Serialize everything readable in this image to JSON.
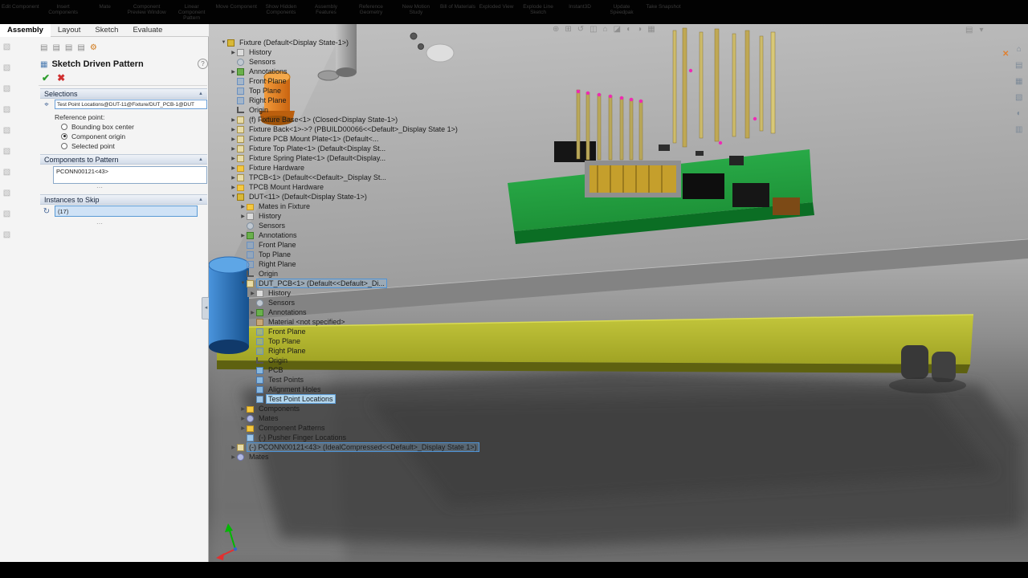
{
  "window": {
    "top_ribbon_labels": [
      "Edit Component",
      "Insert Components",
      "Mate",
      "Component Preview Window",
      "Linear Component Pattern",
      "Move Component",
      "Show Hidden Components",
      "Assembly Features",
      "Reference Geometry",
      "New Motion Study",
      "Bill of Materials",
      "Exploded View",
      "Explode Line Sketch",
      "Instant3D",
      "Update Speedpak",
      "Take Snapshot"
    ]
  },
  "tabs": {
    "items": [
      {
        "label": "Assembly",
        "active": true
      },
      {
        "label": "Layout",
        "active": false
      },
      {
        "label": "Sketch",
        "active": false
      },
      {
        "label": "Evaluate",
        "active": false
      }
    ]
  },
  "left_strip": {
    "icons": [
      "tool-icon-1",
      "tool-icon-2",
      "tool-icon-3",
      "tool-icon-4",
      "tool-icon-5",
      "tool-icon-6",
      "tool-icon-7",
      "tool-icon-8",
      "tool-icon-9",
      "tool-icon-10"
    ]
  },
  "property_manager": {
    "tab_icons": [
      "featuremanager-tab-icon",
      "propertymanager-tab-icon",
      "configuration-manager-tab-icon",
      "dimxpert-manager-tab-icon",
      "display-manager-tab-icon"
    ],
    "title": "Sketch Driven Pattern",
    "help_label": "?",
    "ok_glyph": "✔",
    "cancel_glyph": "✖",
    "groups": {
      "selections": {
        "label": "Selections",
        "field_value": "Test Point Locations@DUT-11@Fixture/DUT_PCB-1@DUT",
        "reference_point_label": "Reference point:",
        "radios": [
          {
            "label": "Bounding box center",
            "selected": false
          },
          {
            "label": "Component origin",
            "selected": true
          },
          {
            "label": "Selected point",
            "selected": false
          }
        ]
      },
      "components": {
        "label": "Components to Pattern",
        "items": [
          "PCONN00121<43>"
        ]
      },
      "instances": {
        "label": "Instances to Skip",
        "field_value": "(17)"
      }
    }
  },
  "feature_tree": {
    "rows": [
      {
        "l": 0,
        "a": "d",
        "i": "asm",
        "t": "Fixture  (Default<Display State-1>)"
      },
      {
        "l": 1,
        "a": "r",
        "i": "history",
        "t": "History"
      },
      {
        "l": 1,
        "a": "",
        "i": "sensors",
        "t": "Sensors"
      },
      {
        "l": 1,
        "a": "r",
        "i": "ann",
        "t": "Annotations"
      },
      {
        "l": 1,
        "a": "",
        "i": "plane",
        "t": "Front Plane"
      },
      {
        "l": 1,
        "a": "",
        "i": "plane",
        "t": "Top Plane"
      },
      {
        "l": 1,
        "a": "",
        "i": "plane",
        "t": "Right Plane"
      },
      {
        "l": 1,
        "a": "",
        "i": "origin",
        "t": "Origin"
      },
      {
        "l": 1,
        "a": "r",
        "i": "part",
        "t": "(f) Fixture Base<1> (Closed<Display State-1>)"
      },
      {
        "l": 1,
        "a": "r",
        "i": "part",
        "t": "Fixture Back<1>->? (PBUILD00066<<Default>_Display State 1>)"
      },
      {
        "l": 1,
        "a": "r",
        "i": "part",
        "t": "Fixture PCB Mount Plate<1> (Default<..."
      },
      {
        "l": 1,
        "a": "r",
        "i": "part",
        "t": "Fixture Top Plate<1> (Default<Display St..."
      },
      {
        "l": 1,
        "a": "r",
        "i": "part",
        "t": "Fixture Spring Plate<1> (Default<Display..."
      },
      {
        "l": 1,
        "a": "r",
        "i": "folder",
        "t": "Fixture Hardware"
      },
      {
        "l": 1,
        "a": "r",
        "i": "part",
        "t": "TPCB<1> (Default<<Default>_Display St..."
      },
      {
        "l": 1,
        "a": "r",
        "i": "folder",
        "t": "TPCB Mount Hardware"
      },
      {
        "l": 1,
        "a": "d",
        "i": "asm",
        "t": "DUT<11> (Default<Display State-1>)"
      },
      {
        "l": 2,
        "a": "r",
        "i": "folder",
        "t": "Mates in Fixture"
      },
      {
        "l": 2,
        "a": "r",
        "i": "history",
        "t": "History"
      },
      {
        "l": 2,
        "a": "",
        "i": "sensors",
        "t": "Sensors"
      },
      {
        "l": 2,
        "a": "r",
        "i": "ann",
        "t": "Annotations"
      },
      {
        "l": 2,
        "a": "",
        "i": "plane",
        "t": "Front Plane"
      },
      {
        "l": 2,
        "a": "",
        "i": "plane",
        "t": "Top Plane"
      },
      {
        "l": 2,
        "a": "",
        "i": "plane",
        "t": "Right Plane"
      },
      {
        "l": 2,
        "a": "",
        "i": "origin",
        "t": "Origin"
      },
      {
        "l": 2,
        "a": "d",
        "i": "part",
        "t": "DUT_PCB<1> (Default<<Default>_Di...",
        "s": "outline"
      },
      {
        "l": 3,
        "a": "r",
        "i": "history",
        "t": "History"
      },
      {
        "l": 3,
        "a": "",
        "i": "sensors",
        "t": "Sensors"
      },
      {
        "l": 3,
        "a": "r",
        "i": "ann",
        "t": "Annotations"
      },
      {
        "l": 3,
        "a": "",
        "i": "mat",
        "t": "Material <not specified>"
      },
      {
        "l": 3,
        "a": "",
        "i": "plane",
        "t": "Front Plane"
      },
      {
        "l": 3,
        "a": "",
        "i": "plane",
        "t": "Top Plane"
      },
      {
        "l": 3,
        "a": "",
        "i": "plane",
        "t": "Right Plane"
      },
      {
        "l": 3,
        "a": "",
        "i": "origin",
        "t": "Origin"
      },
      {
        "l": 3,
        "a": "",
        "i": "feat",
        "t": "PCB"
      },
      {
        "l": 3,
        "a": "",
        "i": "feat",
        "t": "Test Points"
      },
      {
        "l": 3,
        "a": "",
        "i": "feat",
        "t": "Alignment Holes"
      },
      {
        "l": 3,
        "a": "",
        "i": "sketch",
        "t": "Test Point Locations",
        "s": "fill"
      },
      {
        "l": 2,
        "a": "r",
        "i": "folder",
        "t": "Components"
      },
      {
        "l": 2,
        "a": "r",
        "i": "mates",
        "t": "Mates"
      },
      {
        "l": 2,
        "a": "r",
        "i": "folder",
        "t": "Component Patterns"
      },
      {
        "l": 2,
        "a": "",
        "i": "sketch",
        "t": "(-) Pusher Finger Locations"
      },
      {
        "l": 1,
        "a": "r",
        "i": "part",
        "t": "(-) PCONN00121<43> (IdealCompressed<<Default>_Display State 1>)",
        "s": "outline"
      },
      {
        "l": 1,
        "a": "r",
        "i": "mates",
        "t": "Mates"
      }
    ]
  },
  "viewport": {
    "headsup_icons": [
      "zoom-fit-icon",
      "zoom-area-icon",
      "previous-view-icon",
      "section-view-icon",
      "view-orientation-icon",
      "display-style-icon",
      "hide-show-icon",
      "appearance-icon",
      "scene-icon"
    ],
    "top_right_icons": [
      "camera-icon",
      "options-icon"
    ],
    "right_toolbar_icons": [
      "resources-icon",
      "design-library-icon",
      "file-explorer-icon",
      "view-palette-icon",
      "appearances-icon",
      "custom-properties-icon"
    ]
  },
  "colors": {
    "selection_blue": "#5d9bd3",
    "pcb_green": "#23a83e",
    "spring_plate_yellow": "#b4b72e",
    "pogo_pin_tan": "#cbb564",
    "orange_part": "#e07a18",
    "blue_cylinder": "#2a7fd4",
    "test_point_magenta": "#ee2ab4"
  }
}
